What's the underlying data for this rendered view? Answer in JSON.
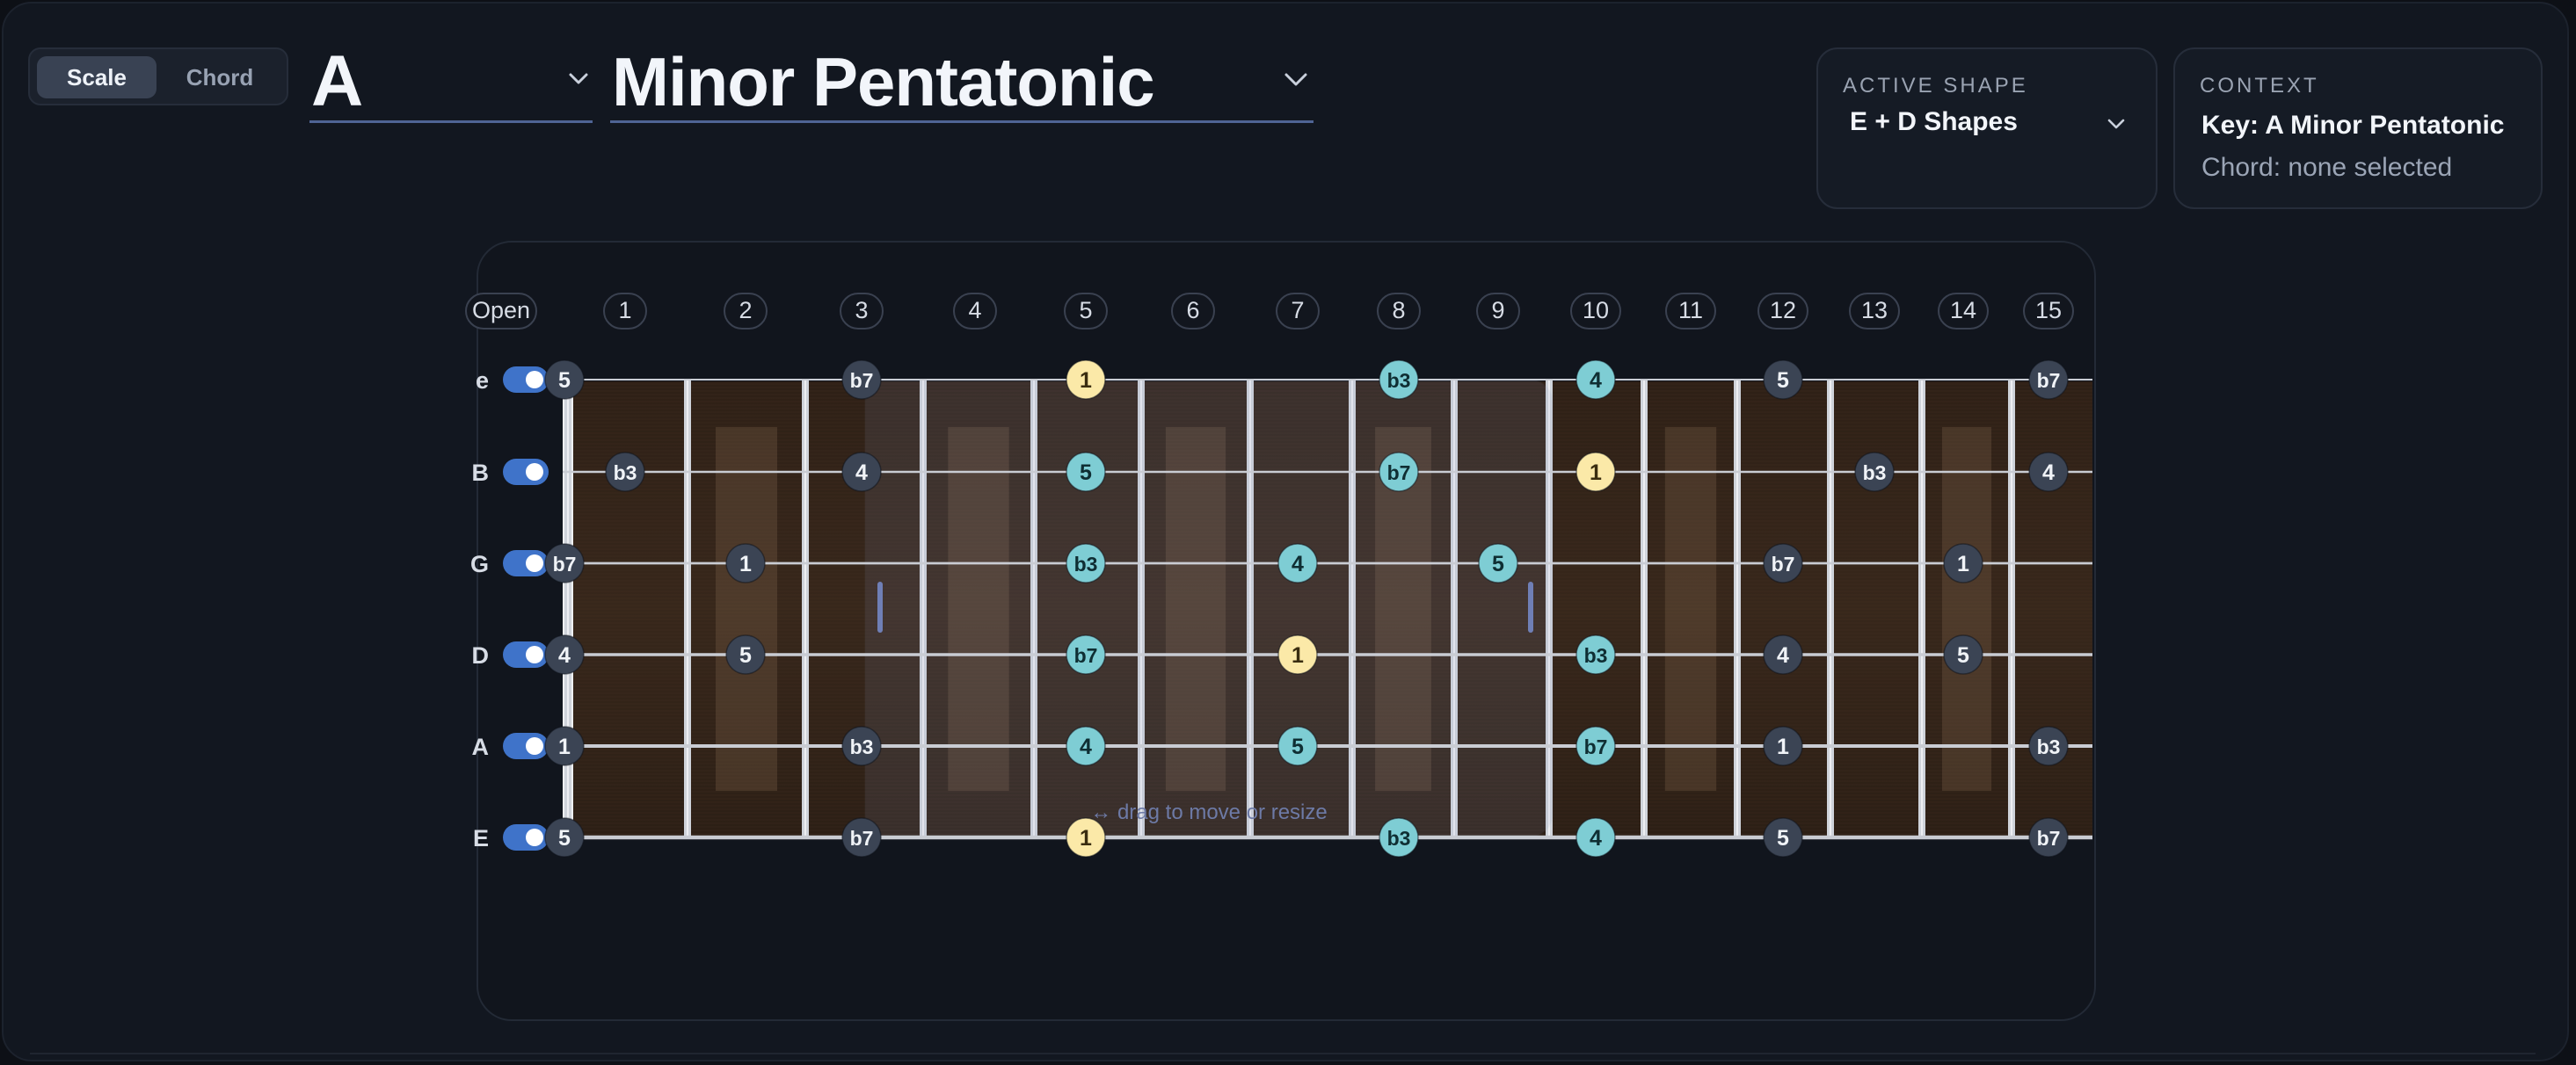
{
  "mode_toggle": {
    "options": [
      "Scale",
      "Chord"
    ],
    "active": "Scale"
  },
  "root_select": {
    "value": "A"
  },
  "scale_select": {
    "value": "Minor Pentatonic"
  },
  "active_shape": {
    "caption": "ACTIVE SHAPE",
    "value": "E + D Shapes"
  },
  "context": {
    "caption": "CONTEXT",
    "key": "Key: A Minor Pentatonic",
    "chord": "Chord: none selected"
  },
  "colors": {
    "shape_note": "#7ecdd4",
    "root_in_shape": "#fbe9a8",
    "outside_note": "#3b4454",
    "wood": "#2a1c14"
  },
  "fretboard": {
    "fret_labels": [
      "Open",
      "1",
      "2",
      "3",
      "4",
      "5",
      "6",
      "7",
      "8",
      "9",
      "10",
      "11",
      "12",
      "13",
      "14",
      "15"
    ],
    "strings": [
      {
        "name": "e",
        "enabled": true,
        "notes": [
          [
            0,
            "5"
          ],
          [
            3,
            "b7"
          ],
          [
            5,
            "1"
          ],
          [
            8,
            "b3"
          ],
          [
            10,
            "4"
          ],
          [
            12,
            "5"
          ],
          [
            15,
            "b7"
          ]
        ]
      },
      {
        "name": "B",
        "enabled": true,
        "notes": [
          [
            1,
            "b3"
          ],
          [
            3,
            "4"
          ],
          [
            5,
            "5"
          ],
          [
            8,
            "b7"
          ],
          [
            10,
            "1"
          ],
          [
            13,
            "b3"
          ],
          [
            15,
            "4"
          ]
        ]
      },
      {
        "name": "G",
        "enabled": true,
        "notes": [
          [
            0,
            "b7"
          ],
          [
            2,
            "1"
          ],
          [
            5,
            "b3"
          ],
          [
            7,
            "4"
          ],
          [
            9,
            "5"
          ],
          [
            12,
            "b7"
          ],
          [
            14,
            "1"
          ]
        ]
      },
      {
        "name": "D",
        "enabled": true,
        "notes": [
          [
            0,
            "4"
          ],
          [
            2,
            "5"
          ],
          [
            5,
            "b7"
          ],
          [
            7,
            "1"
          ],
          [
            10,
            "b3"
          ],
          [
            12,
            "4"
          ],
          [
            14,
            "5"
          ]
        ]
      },
      {
        "name": "A",
        "enabled": true,
        "notes": [
          [
            0,
            "1"
          ],
          [
            3,
            "b3"
          ],
          [
            5,
            "4"
          ],
          [
            7,
            "5"
          ],
          [
            10,
            "b7"
          ],
          [
            12,
            "1"
          ],
          [
            15,
            "b3"
          ]
        ]
      },
      {
        "name": "E",
        "enabled": true,
        "notes": [
          [
            0,
            "5"
          ],
          [
            3,
            "b7"
          ],
          [
            5,
            "1"
          ],
          [
            8,
            "b3"
          ],
          [
            10,
            "4"
          ],
          [
            12,
            "5"
          ],
          [
            15,
            "b7"
          ]
        ]
      }
    ],
    "inlay_frets": [
      3,
      5,
      7,
      9,
      12,
      15
    ],
    "shape_window": {
      "from_fret": 5,
      "to_fret": 10,
      "hint": "↔ drag to move or resize"
    }
  }
}
